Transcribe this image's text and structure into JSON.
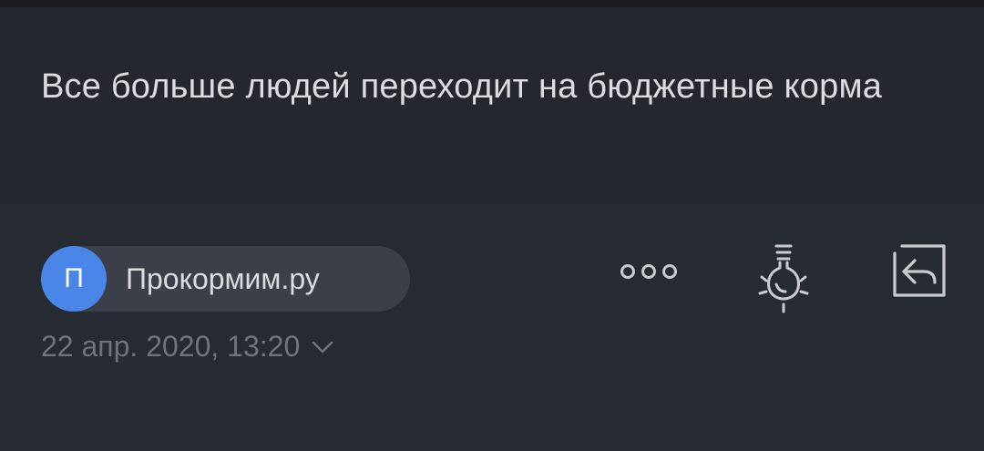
{
  "letter": {
    "subject": "Все больше людей переходит на бюджетные корма"
  },
  "sender": {
    "avatar_letter": "П",
    "name": "Прокормим.ру",
    "avatar_color": "#4a86e8"
  },
  "date": {
    "text": "22 апр. 2020, 13:20",
    "expand_icon": "chevron-down-icon"
  },
  "actions": {
    "more_icon": "more-dots-icon",
    "hint_icon": "lightbulb-icon",
    "reply_icon": "reply-icon"
  },
  "colors": {
    "background": "#24272e",
    "meta_background": "#262a31",
    "chip_background": "#3b3f47",
    "primary_text": "#dcdde0",
    "secondary_text": "#6f737b"
  }
}
